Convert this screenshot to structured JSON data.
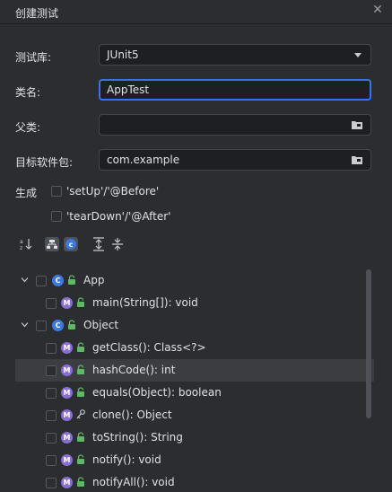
{
  "dialog": {
    "title": "创建测试",
    "close_icon": "close-icon"
  },
  "form": {
    "library_label": "测试库:",
    "library_value": "JUnit5",
    "class_name_label": "类名:",
    "class_name_value": "AppTest",
    "superclass_label": "父类:",
    "superclass_value": "",
    "package_label": "目标软件包:",
    "package_value": "com.example"
  },
  "generate": {
    "label": "生成",
    "setup": {
      "label": "'setUp'/'@Before'",
      "checked": false
    },
    "teardown": {
      "label": "'tearDown'/'@After'",
      "checked": false
    }
  },
  "toolbar": {
    "icons": [
      "sort-alpha-icon",
      "show-hierarchy-icon",
      "class-filter-icon",
      "expand-all-icon",
      "collapse-all-icon"
    ]
  },
  "tree": {
    "rows": [
      {
        "kind": "class",
        "text": "App",
        "expanded": true,
        "selected": false
      },
      {
        "kind": "method",
        "text": "main(String[]): void",
        "selected": false,
        "access": "public",
        "static": true
      },
      {
        "kind": "class",
        "text": "Object",
        "expanded": true,
        "selected": false
      },
      {
        "kind": "method",
        "text": "getClass(): Class<?>",
        "selected": false,
        "access": "public",
        "static": false
      },
      {
        "kind": "method",
        "text": "hashCode(): int",
        "selected": true,
        "access": "public",
        "static": false
      },
      {
        "kind": "method",
        "text": "equals(Object): boolean",
        "selected": false,
        "access": "public",
        "static": false
      },
      {
        "kind": "method",
        "text": "clone(): Object",
        "selected": false,
        "access": "protected",
        "static": false
      },
      {
        "kind": "method",
        "text": "toString(): String",
        "selected": false,
        "access": "public",
        "static": false
      },
      {
        "kind": "method",
        "text": "notify(): void",
        "selected": false,
        "access": "public",
        "static": false
      },
      {
        "kind": "method",
        "text": "notifyAll(): void",
        "selected": false,
        "access": "public",
        "static": false
      }
    ]
  },
  "colors": {
    "background": "#2b2d30",
    "field_bg": "#1e1f22",
    "focus": "#3574f0",
    "class_badge": "#3d7ae0",
    "method_badge": "#8a6fd3",
    "lock": "#5fb865"
  }
}
